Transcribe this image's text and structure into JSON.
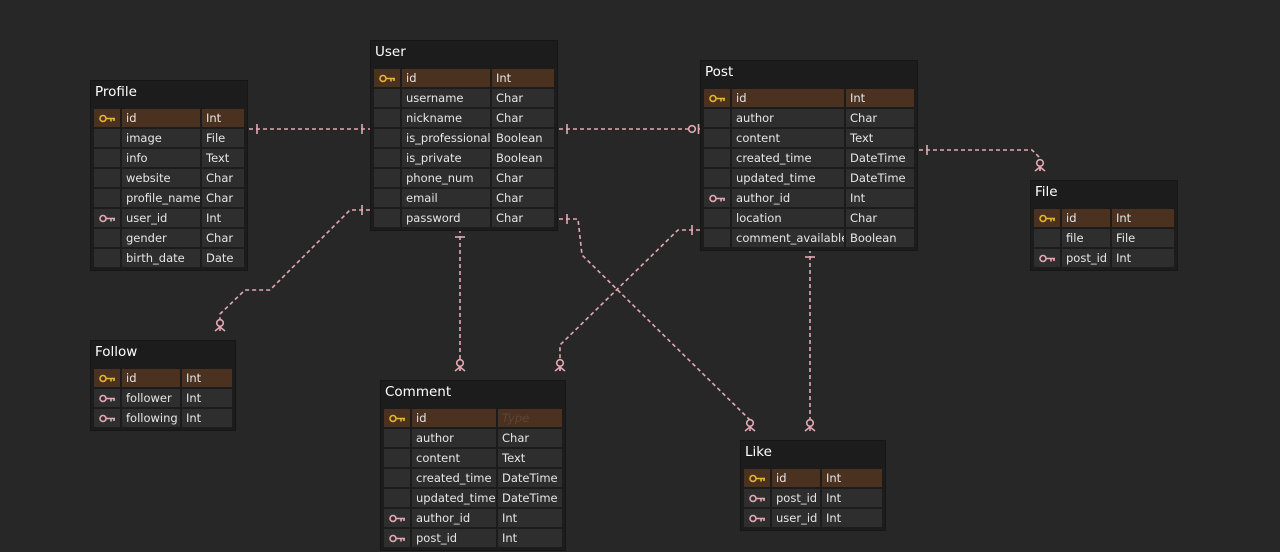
{
  "colors": {
    "background": "#272727",
    "table_bg": "#1c1c1c",
    "cell_bg": "#2e2e2e",
    "pk_row_bg": "#4a3120",
    "pk_key": "#e6b530",
    "fk_key": "#e3a9b3",
    "relation_line": "#e3a9b3"
  },
  "tables": [
    {
      "id": "profile",
      "title": "Profile",
      "columns": [
        {
          "key": "pk",
          "name": "id",
          "type": "Int"
        },
        {
          "key": "",
          "name": "image",
          "type": "File"
        },
        {
          "key": "",
          "name": "info",
          "type": "Text"
        },
        {
          "key": "",
          "name": "website",
          "type": "Char"
        },
        {
          "key": "",
          "name": "profile_name",
          "type": "Char"
        },
        {
          "key": "fk",
          "name": "user_id",
          "type": "Int"
        },
        {
          "key": "",
          "name": "gender",
          "type": "Char"
        },
        {
          "key": "",
          "name": "birth_date",
          "type": "Date"
        }
      ]
    },
    {
      "id": "user",
      "title": "User",
      "columns": [
        {
          "key": "pk",
          "name": "id",
          "type": "Int"
        },
        {
          "key": "",
          "name": "username",
          "type": "Char"
        },
        {
          "key": "",
          "name": "nickname",
          "type": "Char"
        },
        {
          "key": "",
          "name": "is_professional",
          "type": "Boolean"
        },
        {
          "key": "",
          "name": "is_private",
          "type": "Boolean"
        },
        {
          "key": "",
          "name": "phone_num",
          "type": "Char"
        },
        {
          "key": "",
          "name": "email",
          "type": "Char"
        },
        {
          "key": "",
          "name": "password",
          "type": "Char"
        }
      ]
    },
    {
      "id": "post",
      "title": "Post",
      "columns": [
        {
          "key": "pk",
          "name": "id",
          "type": "Int"
        },
        {
          "key": "",
          "name": "author",
          "type": "Char"
        },
        {
          "key": "",
          "name": "content",
          "type": "Text"
        },
        {
          "key": "",
          "name": "created_time",
          "type": "DateTime"
        },
        {
          "key": "",
          "name": "updated_time",
          "type": "DateTime"
        },
        {
          "key": "fk",
          "name": "author_id",
          "type": "Int"
        },
        {
          "key": "",
          "name": "location",
          "type": "Char"
        },
        {
          "key": "",
          "name": "comment_available",
          "type": "Boolean"
        }
      ]
    },
    {
      "id": "file",
      "title": "File",
      "columns": [
        {
          "key": "pk",
          "name": "id",
          "type": "Int"
        },
        {
          "key": "",
          "name": "file",
          "type": "File"
        },
        {
          "key": "fk",
          "name": "post_id",
          "type": "Int"
        }
      ]
    },
    {
      "id": "follow",
      "title": "Follow",
      "columns": [
        {
          "key": "pk",
          "name": "id",
          "type": "Int"
        },
        {
          "key": "fk",
          "name": "follower",
          "type": "Int"
        },
        {
          "key": "fk",
          "name": "following",
          "type": "Int"
        }
      ]
    },
    {
      "id": "comment",
      "title": "Comment",
      "columns": [
        {
          "key": "pk",
          "name": "id",
          "type": "",
          "type_placeholder": "Type"
        },
        {
          "key": "",
          "name": "author",
          "type": "Char"
        },
        {
          "key": "",
          "name": "content",
          "type": "Text"
        },
        {
          "key": "",
          "name": "created_time",
          "type": "DateTime"
        },
        {
          "key": "",
          "name": "updated_time",
          "type": "DateTime"
        },
        {
          "key": "fk",
          "name": "author_id",
          "type": "Int"
        },
        {
          "key": "fk",
          "name": "post_id",
          "type": "Int"
        }
      ]
    },
    {
      "id": "like",
      "title": "Like",
      "columns": [
        {
          "key": "pk",
          "name": "id",
          "type": "Int"
        },
        {
          "key": "fk",
          "name": "post_id",
          "type": "Int"
        },
        {
          "key": "fk",
          "name": "user_id",
          "type": "Int"
        }
      ]
    }
  ],
  "relations": [
    {
      "id": "profile-user",
      "from": "profile",
      "to": "user",
      "from_end": "one",
      "to_end": "one"
    },
    {
      "id": "user-post",
      "from": "user",
      "to": "post",
      "from_end": "one",
      "to_end": "zero-or-one"
    },
    {
      "id": "post-file",
      "from": "post",
      "to": "file",
      "from_end": "one",
      "to_end": "zero-or-many"
    },
    {
      "id": "user-follow",
      "from": "user",
      "to": "follow",
      "from_end": "one",
      "to_end": "zero-or-many"
    },
    {
      "id": "user-comment",
      "from": "user",
      "to": "comment",
      "from_end": "one",
      "to_end": "zero-or-many"
    },
    {
      "id": "post-comment",
      "from": "post",
      "to": "comment",
      "from_end": "one",
      "to_end": "zero-or-many"
    },
    {
      "id": "user-like",
      "from": "user",
      "to": "like",
      "from_end": "one",
      "to_end": "zero-or-many"
    },
    {
      "id": "post-like",
      "from": "post",
      "to": "like",
      "from_end": "one",
      "to_end": "zero-or-many"
    }
  ]
}
